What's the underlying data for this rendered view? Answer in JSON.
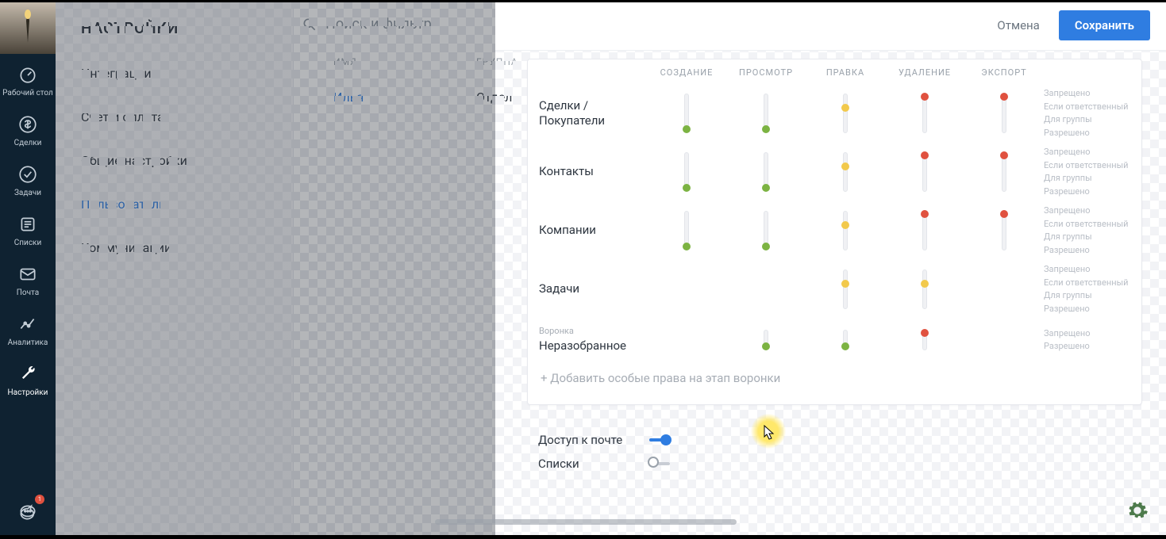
{
  "nav": {
    "items": [
      {
        "label": "Рабочий\nстол"
      },
      {
        "label": "Сделки"
      },
      {
        "label": "Задачи"
      },
      {
        "label": "Списки"
      },
      {
        "label": "Почта"
      },
      {
        "label": "Аналитика"
      },
      {
        "label": "Настройки"
      }
    ],
    "chat_badge": "1"
  },
  "settings": {
    "title": "НАСТРОЙКИ",
    "items": [
      "Интеграции",
      "Счет и оплата",
      "Общие настройки",
      "Пользователи",
      "Коммуникации"
    ],
    "active_index": 3
  },
  "mid": {
    "search_placeholder": "Поиск и фильтр",
    "col_name": "ИМЯ",
    "col_group": "ГРУППА",
    "row_name": "Илья",
    "row_group": "Отдел"
  },
  "drawer": {
    "cancel": "Отмена",
    "save": "Сохранить",
    "columns": [
      "СОЗДАНИЕ",
      "ПРОСМОТР",
      "ПРАВКА",
      "УДАЛЕНИЕ",
      "ЭКСПОРТ"
    ],
    "legend4": [
      "Запрещено",
      "Если ответственный",
      "Для группы",
      "Разрешено"
    ],
    "legend2": [
      "Запрещено",
      "Разрешено"
    ],
    "rows": [
      {
        "label": "Сделки / Покупатели",
        "cells": [
          {
            "lvls": 4,
            "pos": 3,
            "color": "green"
          },
          {
            "lvls": 4,
            "pos": 3,
            "color": "green"
          },
          {
            "lvls": 4,
            "pos": 1,
            "color": "yellow"
          },
          {
            "lvls": 4,
            "pos": 0,
            "color": "red"
          },
          {
            "lvls": 4,
            "pos": 0,
            "color": "red"
          }
        ],
        "legend": "4"
      },
      {
        "label": "Контакты",
        "cells": [
          {
            "lvls": 4,
            "pos": 3,
            "color": "green"
          },
          {
            "lvls": 4,
            "pos": 3,
            "color": "green"
          },
          {
            "lvls": 4,
            "pos": 1,
            "color": "yellow"
          },
          {
            "lvls": 4,
            "pos": 0,
            "color": "red"
          },
          {
            "lvls": 4,
            "pos": 0,
            "color": "red"
          }
        ],
        "legend": "4"
      },
      {
        "label": "Компании",
        "cells": [
          {
            "lvls": 4,
            "pos": 3,
            "color": "green"
          },
          {
            "lvls": 4,
            "pos": 3,
            "color": "green"
          },
          {
            "lvls": 4,
            "pos": 1,
            "color": "yellow"
          },
          {
            "lvls": 4,
            "pos": 0,
            "color": "red"
          },
          {
            "lvls": 4,
            "pos": 0,
            "color": "red"
          }
        ],
        "legend": "4"
      },
      {
        "label": "Задачи",
        "cells": [
          null,
          null,
          {
            "lvls": 4,
            "pos": 1,
            "color": "yellow"
          },
          {
            "lvls": 4,
            "pos": 1,
            "color": "yellow"
          },
          null
        ],
        "legend": "4"
      },
      {
        "label": "Неразобранное",
        "sublabel": "Воронка",
        "cells": [
          null,
          {
            "lvls": 2,
            "pos": 1,
            "color": "green"
          },
          {
            "lvls": 2,
            "pos": 1,
            "color": "green"
          },
          {
            "lvls": 2,
            "pos": 0,
            "color": "red"
          },
          null
        ],
        "legend": "2",
        "short": true
      }
    ],
    "add_stage": "+  Добавить особые права на этап воронки",
    "toggle_mail_label": "Доступ к почте",
    "toggle_mail_on": true,
    "toggle_lists_label": "Списки",
    "toggle_lists_on": false
  }
}
